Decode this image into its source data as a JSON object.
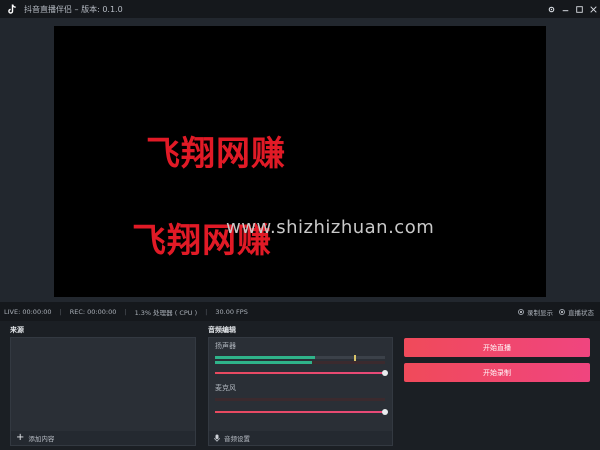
{
  "titlebar": {
    "app_title": "抖音直播伴侣 – 版本: 0.1.0",
    "icons": [
      "tiktok-logo-icon",
      "gear-icon",
      "minimize-icon",
      "maximize-icon",
      "close-icon"
    ]
  },
  "preview": {
    "watermark_1": "飞翔网赚",
    "watermark_2": "飞翔网赚",
    "watermark_url": "www.shizhizhuan.com"
  },
  "status": {
    "live": "LIVE: 00:00:00",
    "rec": "REC: 00:00:00",
    "cpu": "1.3% 处理器 ( CPU )",
    "fps": "30.00 FPS",
    "option_1": "录制显示",
    "option_2": "直播状态"
  },
  "sources": {
    "title": "来源",
    "add_label": "添加内容"
  },
  "audio": {
    "title": "音频编辑",
    "speaker_label": "扬声器",
    "mic_label": "麦克风",
    "settings_label": "音频设置",
    "speaker_level": 0.82,
    "speaker_volume": 1.0,
    "mic_volume": 1.0
  },
  "actions": {
    "start_live": "开始直播",
    "start_record": "开始录制"
  },
  "colors": {
    "accent": "#f04a5a",
    "watermark": "#e11a26",
    "meter_green": "#2fb38a"
  }
}
